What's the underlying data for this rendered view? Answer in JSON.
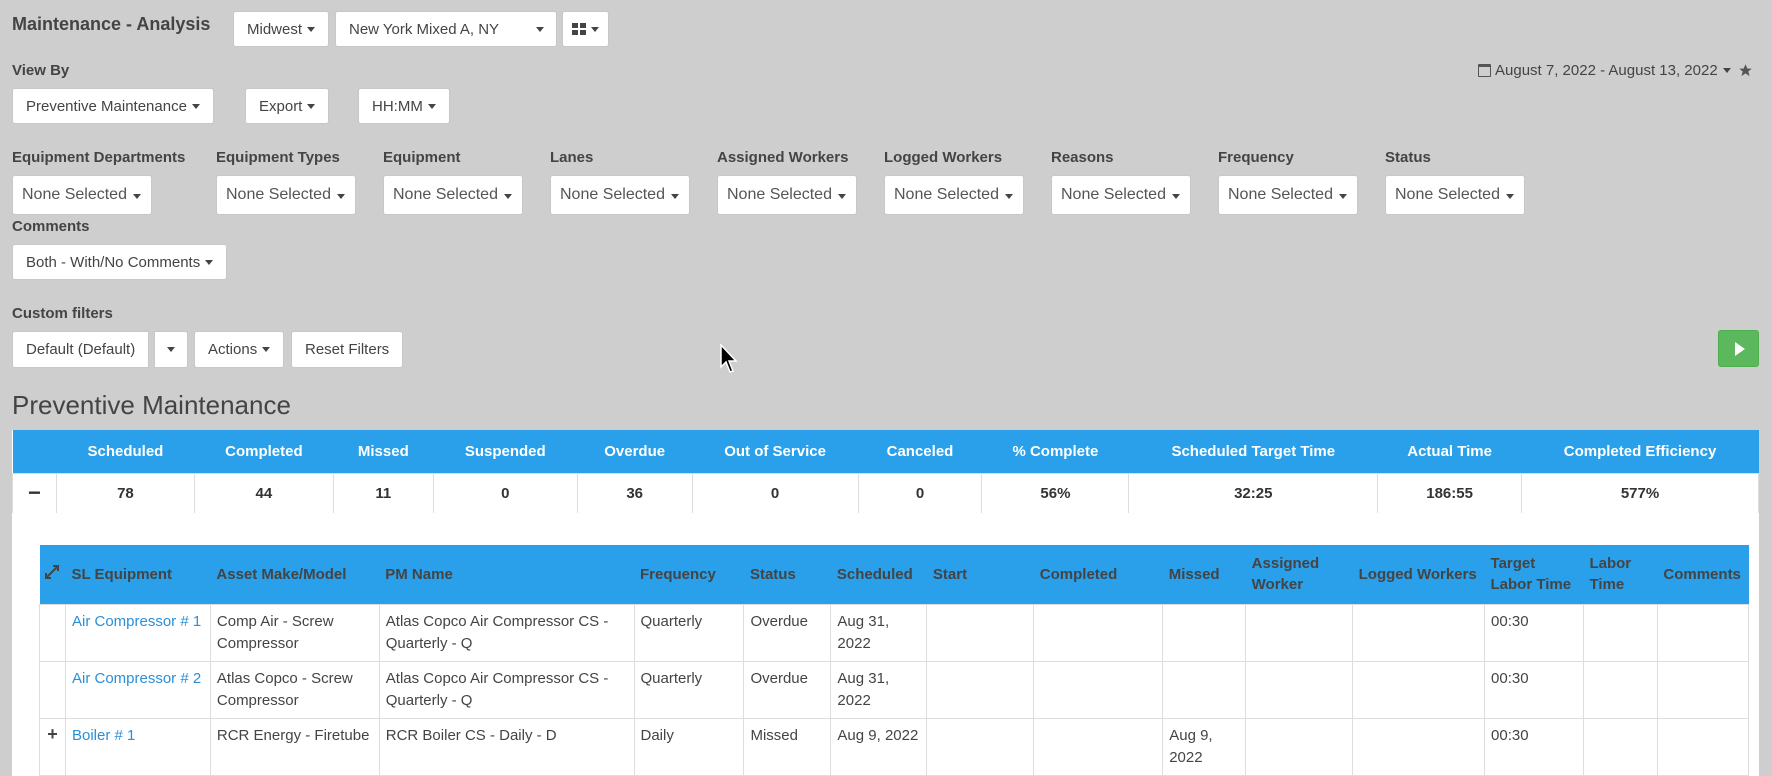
{
  "page": {
    "title": "Maintenance - Analysis"
  },
  "top": {
    "region": "Midwest",
    "site": "New York Mixed A, NY"
  },
  "view_by": {
    "label": "View By",
    "value": "Preventive Maintenance",
    "export": "Export",
    "time_format": "HH:MM"
  },
  "date_range": "August 7, 2022 - August 13, 2022",
  "filters": [
    {
      "label": "Equipment Departments",
      "value": "None Selected"
    },
    {
      "label": "Equipment Types",
      "value": "None Selected"
    },
    {
      "label": "Equipment",
      "value": "None Selected"
    },
    {
      "label": "Lanes",
      "value": "None Selected"
    },
    {
      "label": "Assigned Workers",
      "value": "None Selected"
    },
    {
      "label": "Logged Workers",
      "value": "None Selected"
    },
    {
      "label": "Reasons",
      "value": "None Selected"
    },
    {
      "label": "Frequency",
      "value": "None Selected"
    },
    {
      "label": "Status",
      "value": "None Selected"
    }
  ],
  "comments": {
    "label": "Comments",
    "value": "Both - With/No Comments"
  },
  "custom_filters": {
    "label": "Custom filters",
    "value": "Default (Default)",
    "actions": "Actions",
    "reset": "Reset Filters"
  },
  "section_title": "Preventive Maintenance",
  "summary": {
    "collapse_symbol": "−",
    "headers": [
      "Scheduled",
      "Completed",
      "Missed",
      "Suspended",
      "Overdue",
      "Out of Service",
      "Canceled",
      "% Complete",
      "Scheduled Target Time",
      "Actual Time",
      "Completed Efficiency"
    ],
    "values": [
      "78",
      "44",
      "11",
      "0",
      "36",
      "0",
      "0",
      "56%",
      "32:25",
      "186:55",
      "577%"
    ]
  },
  "detail": {
    "headers": {
      "equipment": "SL Equipment",
      "make": "Asset Make/Model",
      "pm": "PM Name",
      "frequency": "Frequency",
      "status": "Status",
      "scheduled": "Scheduled",
      "start": "Start",
      "completed": "Completed",
      "missed": "Missed",
      "assigned": "Assigned Worker",
      "logged": "Logged Workers",
      "target": "Target Labor Time",
      "labor": "Labor Time",
      "comments": "Comments"
    },
    "rows": [
      {
        "expand": "",
        "equipment": "Air Compressor # 1",
        "make": "Comp Air - Screw Compressor",
        "pm": "Atlas Copco Air Compressor CS - Quarterly - Q",
        "frequency": "Quarterly",
        "status": "Overdue",
        "scheduled": "Aug 31, 2022",
        "start": "",
        "completed": "",
        "missed": "",
        "assigned": "",
        "logged": "",
        "target": "00:30",
        "labor": "",
        "comments": ""
      },
      {
        "expand": "",
        "equipment": "Air Compressor # 2",
        "make": "Atlas Copco - Screw Compressor",
        "pm": "Atlas Copco Air Compressor CS - Quarterly - Q",
        "frequency": "Quarterly",
        "status": "Overdue",
        "scheduled": "Aug 31, 2022",
        "start": "",
        "completed": "",
        "missed": "",
        "assigned": "",
        "logged": "",
        "target": "00:30",
        "labor": "",
        "comments": ""
      },
      {
        "expand": "+",
        "equipment": "Boiler # 1",
        "make": "RCR Energy - Firetube",
        "pm": "RCR Boiler CS - Daily - D",
        "frequency": "Daily",
        "status": "Missed",
        "scheduled": "Aug 9, 2022",
        "start": "",
        "completed": "",
        "missed": "Aug 9, 2022",
        "assigned": "",
        "logged": "",
        "target": "00:30",
        "labor": "",
        "comments": ""
      }
    ]
  }
}
